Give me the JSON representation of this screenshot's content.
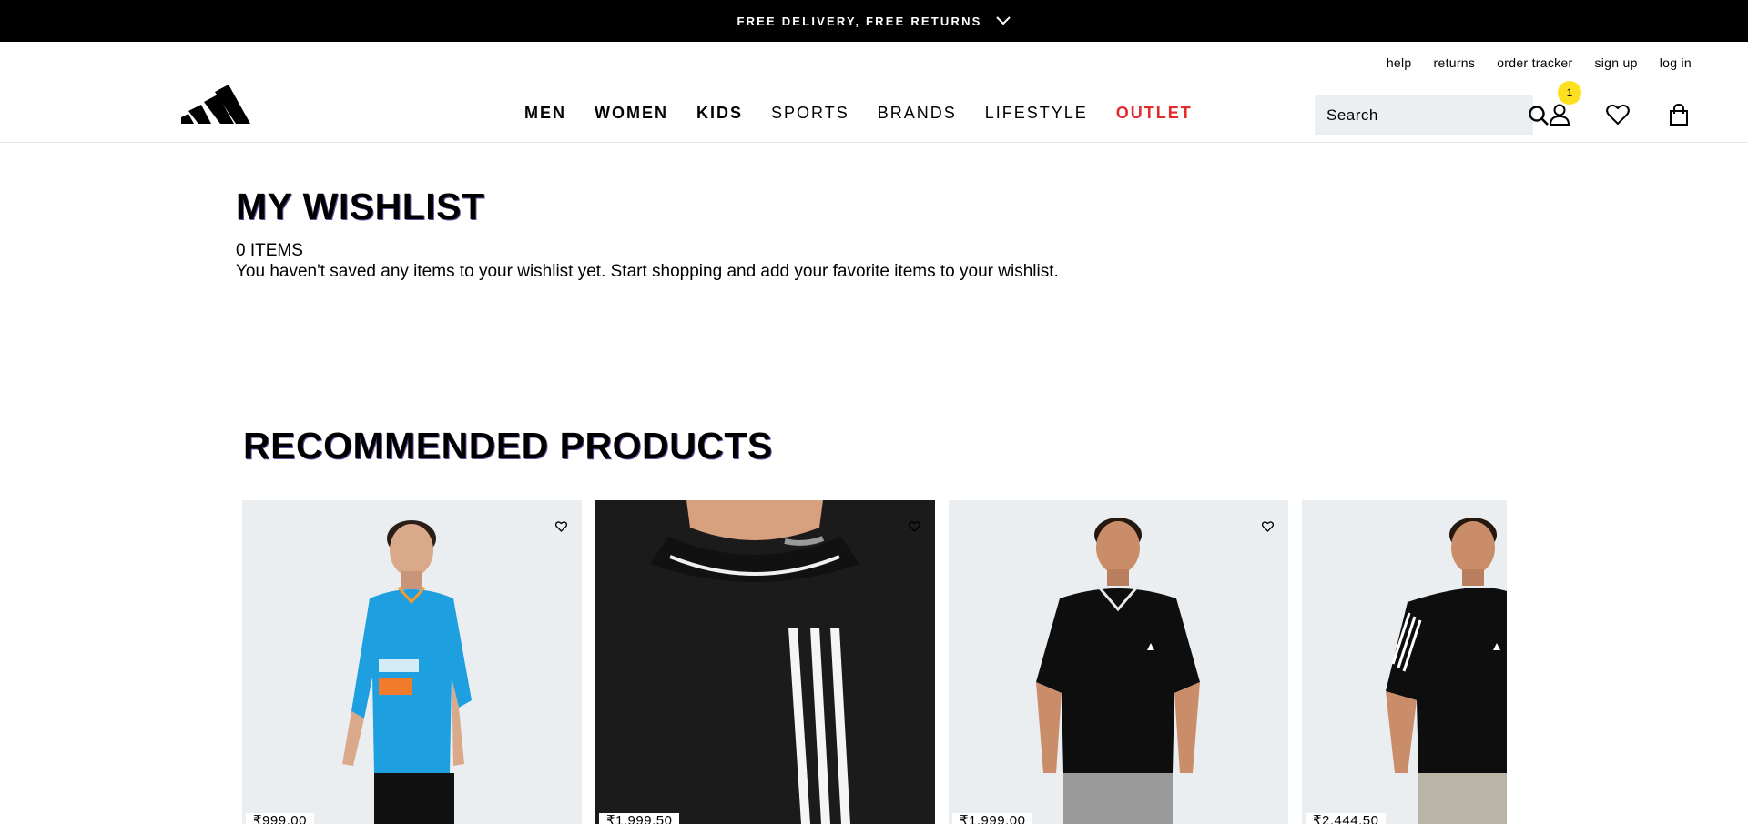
{
  "promo": {
    "text": "FREE DELIVERY, FREE RETURNS",
    "chevron_icon": "chevron-down-icon"
  },
  "utility_nav": [
    {
      "label": "help"
    },
    {
      "label": "returns"
    },
    {
      "label": "order tracker"
    },
    {
      "label": "sign up"
    },
    {
      "label": "log in"
    }
  ],
  "main_nav": [
    {
      "label": "MEN"
    },
    {
      "label": "WOMEN"
    },
    {
      "label": "KIDS"
    },
    {
      "label": "SPORTS"
    },
    {
      "label": "BRANDS"
    },
    {
      "label": "LIFESTYLE"
    },
    {
      "label": "OUTLET"
    }
  ],
  "search": {
    "placeholder": "Search"
  },
  "account": {
    "badge_count": "1"
  },
  "wishlist": {
    "title": "MY WISHLIST",
    "count_text": "0 ITEMS",
    "empty_message": "You haven't saved any items to your wishlist yet. Start shopping and add your favorite items to your wishlist."
  },
  "recommended": {
    "title": "RECOMMENDED PRODUCTS",
    "products": [
      {
        "price": "₹999.00",
        "icon": "heart-icon"
      },
      {
        "price": "₹1,999.50",
        "icon": "heart-icon"
      },
      {
        "price": "₹1,999.00",
        "icon": "heart-icon"
      },
      {
        "price": "₹2,444.50",
        "icon": "heart-icon"
      }
    ]
  },
  "colors": {
    "promo_bg": "#000000",
    "outlet": "#e32b2b",
    "badge": "#fde020",
    "card_bg": "#eaeef0",
    "search_bg": "#eceff1"
  }
}
